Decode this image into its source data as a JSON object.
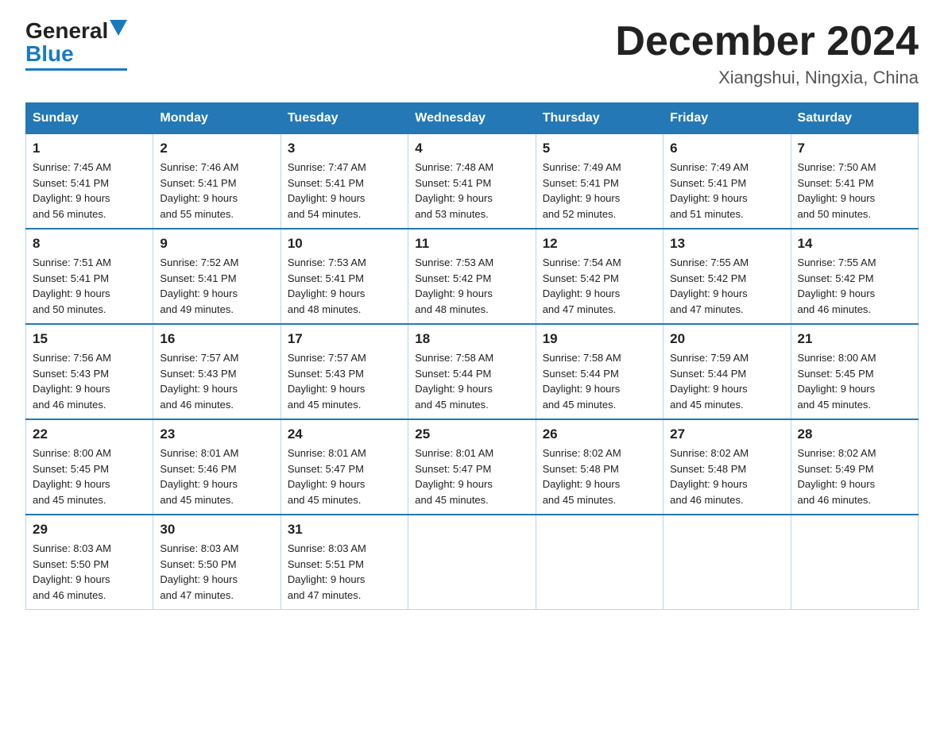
{
  "logo": {
    "text_general": "General",
    "text_blue": "Blue"
  },
  "header": {
    "month": "December 2024",
    "location": "Xiangshui, Ningxia, China"
  },
  "weekdays": [
    "Sunday",
    "Monday",
    "Tuesday",
    "Wednesday",
    "Thursday",
    "Friday",
    "Saturday"
  ],
  "weeks": [
    [
      {
        "day": "1",
        "sunrise": "7:45 AM",
        "sunset": "5:41 PM",
        "daylight": "9 hours and 56 minutes."
      },
      {
        "day": "2",
        "sunrise": "7:46 AM",
        "sunset": "5:41 PM",
        "daylight": "9 hours and 55 minutes."
      },
      {
        "day": "3",
        "sunrise": "7:47 AM",
        "sunset": "5:41 PM",
        "daylight": "9 hours and 54 minutes."
      },
      {
        "day": "4",
        "sunrise": "7:48 AM",
        "sunset": "5:41 PM",
        "daylight": "9 hours and 53 minutes."
      },
      {
        "day": "5",
        "sunrise": "7:49 AM",
        "sunset": "5:41 PM",
        "daylight": "9 hours and 52 minutes."
      },
      {
        "day": "6",
        "sunrise": "7:49 AM",
        "sunset": "5:41 PM",
        "daylight": "9 hours and 51 minutes."
      },
      {
        "day": "7",
        "sunrise": "7:50 AM",
        "sunset": "5:41 PM",
        "daylight": "9 hours and 50 minutes."
      }
    ],
    [
      {
        "day": "8",
        "sunrise": "7:51 AM",
        "sunset": "5:41 PM",
        "daylight": "9 hours and 50 minutes."
      },
      {
        "day": "9",
        "sunrise": "7:52 AM",
        "sunset": "5:41 PM",
        "daylight": "9 hours and 49 minutes."
      },
      {
        "day": "10",
        "sunrise": "7:53 AM",
        "sunset": "5:41 PM",
        "daylight": "9 hours and 48 minutes."
      },
      {
        "day": "11",
        "sunrise": "7:53 AM",
        "sunset": "5:42 PM",
        "daylight": "9 hours and 48 minutes."
      },
      {
        "day": "12",
        "sunrise": "7:54 AM",
        "sunset": "5:42 PM",
        "daylight": "9 hours and 47 minutes."
      },
      {
        "day": "13",
        "sunrise": "7:55 AM",
        "sunset": "5:42 PM",
        "daylight": "9 hours and 47 minutes."
      },
      {
        "day": "14",
        "sunrise": "7:55 AM",
        "sunset": "5:42 PM",
        "daylight": "9 hours and 46 minutes."
      }
    ],
    [
      {
        "day": "15",
        "sunrise": "7:56 AM",
        "sunset": "5:43 PM",
        "daylight": "9 hours and 46 minutes."
      },
      {
        "day": "16",
        "sunrise": "7:57 AM",
        "sunset": "5:43 PM",
        "daylight": "9 hours and 46 minutes."
      },
      {
        "day": "17",
        "sunrise": "7:57 AM",
        "sunset": "5:43 PM",
        "daylight": "9 hours and 45 minutes."
      },
      {
        "day": "18",
        "sunrise": "7:58 AM",
        "sunset": "5:44 PM",
        "daylight": "9 hours and 45 minutes."
      },
      {
        "day": "19",
        "sunrise": "7:58 AM",
        "sunset": "5:44 PM",
        "daylight": "9 hours and 45 minutes."
      },
      {
        "day": "20",
        "sunrise": "7:59 AM",
        "sunset": "5:44 PM",
        "daylight": "9 hours and 45 minutes."
      },
      {
        "day": "21",
        "sunrise": "8:00 AM",
        "sunset": "5:45 PM",
        "daylight": "9 hours and 45 minutes."
      }
    ],
    [
      {
        "day": "22",
        "sunrise": "8:00 AM",
        "sunset": "5:45 PM",
        "daylight": "9 hours and 45 minutes."
      },
      {
        "day": "23",
        "sunrise": "8:01 AM",
        "sunset": "5:46 PM",
        "daylight": "9 hours and 45 minutes."
      },
      {
        "day": "24",
        "sunrise": "8:01 AM",
        "sunset": "5:47 PM",
        "daylight": "9 hours and 45 minutes."
      },
      {
        "day": "25",
        "sunrise": "8:01 AM",
        "sunset": "5:47 PM",
        "daylight": "9 hours and 45 minutes."
      },
      {
        "day": "26",
        "sunrise": "8:02 AM",
        "sunset": "5:48 PM",
        "daylight": "9 hours and 45 minutes."
      },
      {
        "day": "27",
        "sunrise": "8:02 AM",
        "sunset": "5:48 PM",
        "daylight": "9 hours and 46 minutes."
      },
      {
        "day": "28",
        "sunrise": "8:02 AM",
        "sunset": "5:49 PM",
        "daylight": "9 hours and 46 minutes."
      }
    ],
    [
      {
        "day": "29",
        "sunrise": "8:03 AM",
        "sunset": "5:50 PM",
        "daylight": "9 hours and 46 minutes."
      },
      {
        "day": "30",
        "sunrise": "8:03 AM",
        "sunset": "5:50 PM",
        "daylight": "9 hours and 47 minutes."
      },
      {
        "day": "31",
        "sunrise": "8:03 AM",
        "sunset": "5:51 PM",
        "daylight": "9 hours and 47 minutes."
      },
      null,
      null,
      null,
      null
    ]
  ],
  "labels": {
    "sunrise": "Sunrise: ",
    "sunset": "Sunset: ",
    "daylight": "Daylight: "
  }
}
